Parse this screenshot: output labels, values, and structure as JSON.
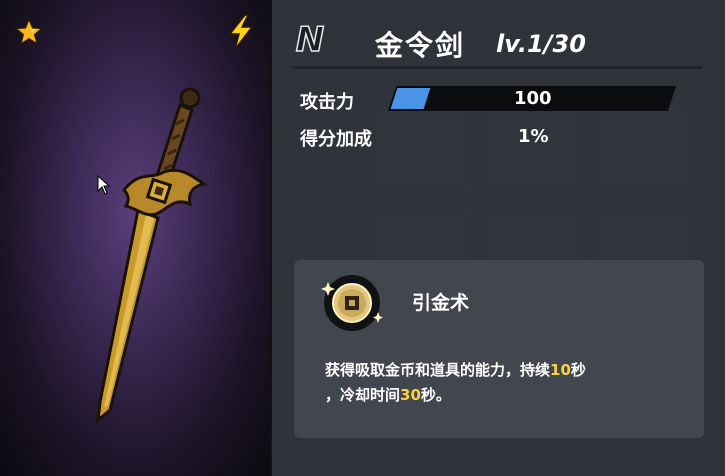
{
  "item": {
    "rarity": "N",
    "name": "金令剑",
    "level": "lv.1/30"
  },
  "stats": [
    {
      "label": "攻击力",
      "value": "100",
      "fill_fraction": 0.12
    },
    {
      "label": "得分加成",
      "value": "1%"
    }
  ],
  "skill": {
    "name": "引金术",
    "desc_part1": "获得吸取金币和道具的能力，持续",
    "duration": "10",
    "desc_part2": "秒",
    "desc_part3": "，冷却时间",
    "cooldown": "30",
    "desc_part4": "秒。"
  },
  "icons": {
    "rarity_star": "star-icon",
    "element": "lightning-bolt-icon",
    "skill": "gold-coin-icon"
  },
  "colors": {
    "stat_fill": "#4a93e6",
    "highlight": "#ffd23a",
    "star": "#f6b81e",
    "bolt": "#ffd31a"
  }
}
